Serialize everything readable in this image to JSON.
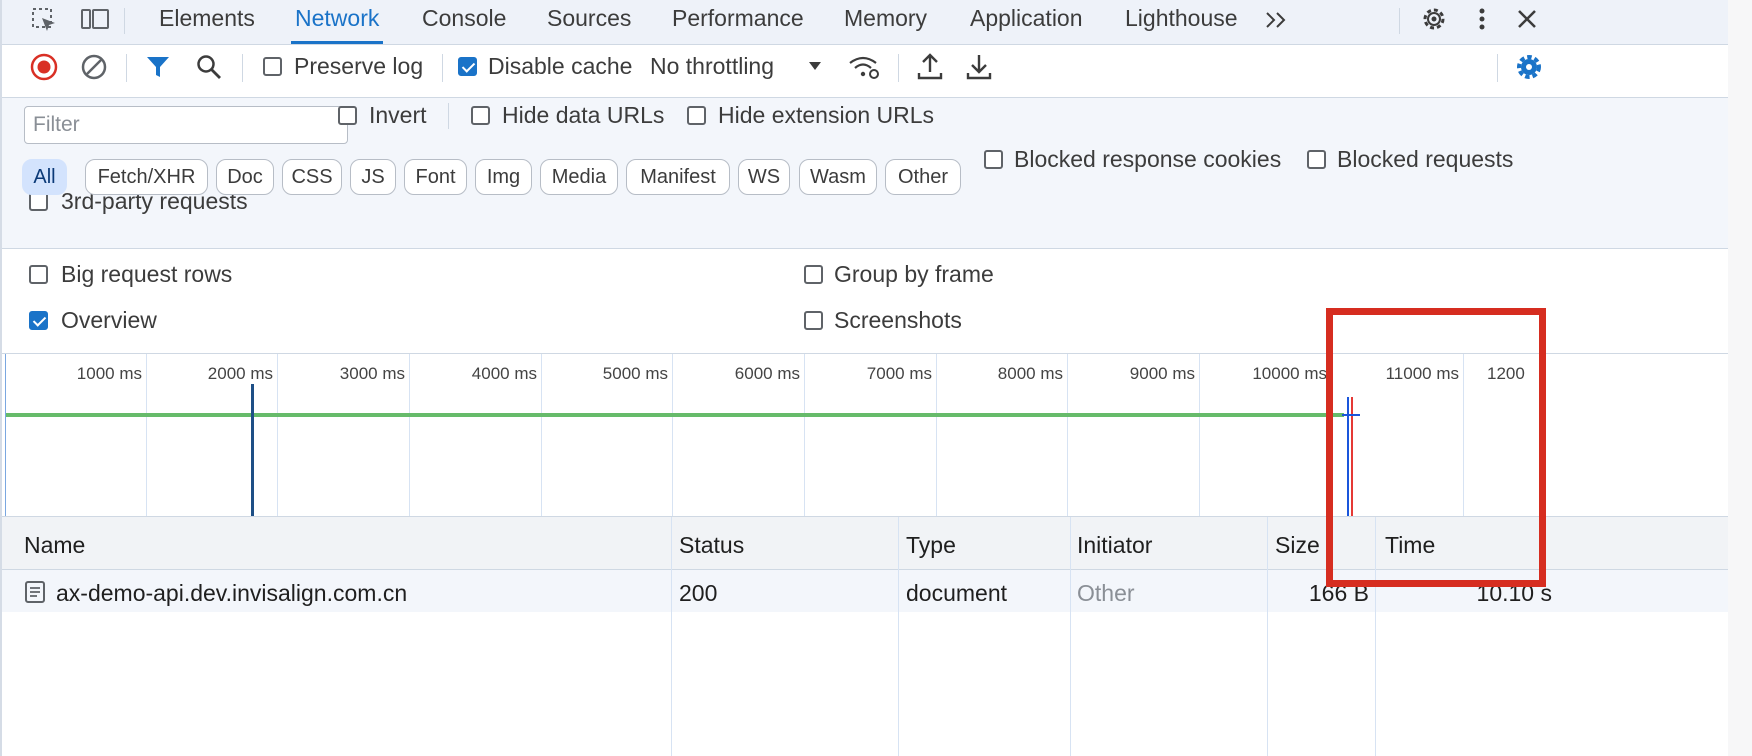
{
  "tabs": [
    {
      "label": "Elements"
    },
    {
      "label": "Network"
    },
    {
      "label": "Console"
    },
    {
      "label": "Sources"
    },
    {
      "label": "Performance"
    },
    {
      "label": "Memory"
    },
    {
      "label": "Application"
    },
    {
      "label": "Lighthouse"
    }
  ],
  "active_tab": "Network",
  "toolbar": {
    "preserve_log": "Preserve log",
    "preserve_log_checked": false,
    "disable_cache": "Disable cache",
    "disable_cache_checked": true,
    "throttling": "No throttling"
  },
  "filter": {
    "placeholder": "Filter",
    "value": "",
    "invert": "Invert",
    "hide_data_urls": "Hide data URLs",
    "hide_extension_urls": "Hide extension URLs",
    "types": [
      "All",
      "Fetch/XHR",
      "Doc",
      "CSS",
      "JS",
      "Font",
      "Img",
      "Media",
      "Manifest",
      "WS",
      "Wasm",
      "Other"
    ],
    "active_type": "All",
    "blocked_response_cookies": "Blocked response cookies",
    "blocked_requests": "Blocked requests",
    "third_party": "3rd-party requests"
  },
  "settings": {
    "big_request_rows": "Big request rows",
    "big_request_rows_checked": false,
    "group_by_frame": "Group by frame",
    "group_by_frame_checked": false,
    "overview": "Overview",
    "overview_checked": true,
    "screenshots": "Screenshots",
    "screenshots_checked": false
  },
  "overview": {
    "ticks": [
      "1000 ms",
      "2000 ms",
      "3000 ms",
      "4000 ms",
      "5000 ms",
      "6000 ms",
      "7000 ms",
      "8000 ms",
      "9000 ms",
      "10000 ms",
      "11000 ms",
      "1200"
    ],
    "request_duration_ms": 10100,
    "dom_content_loaded_ms": 1800,
    "load_event_ms": 10150
  },
  "table": {
    "columns": [
      "Name",
      "Status",
      "Type",
      "Initiator",
      "Size",
      "Time"
    ],
    "rows": [
      {
        "name": "ax-demo-api.dev.invisalign.com.cn",
        "status": "200",
        "type": "document",
        "initiator": "Other",
        "size": "166 B",
        "time": "10.10 s"
      }
    ]
  },
  "colors": {
    "accent": "#1a73c8",
    "record_red": "#d93025",
    "highlight_red": "#d62d20",
    "timeline_green": "#66bb6a"
  }
}
